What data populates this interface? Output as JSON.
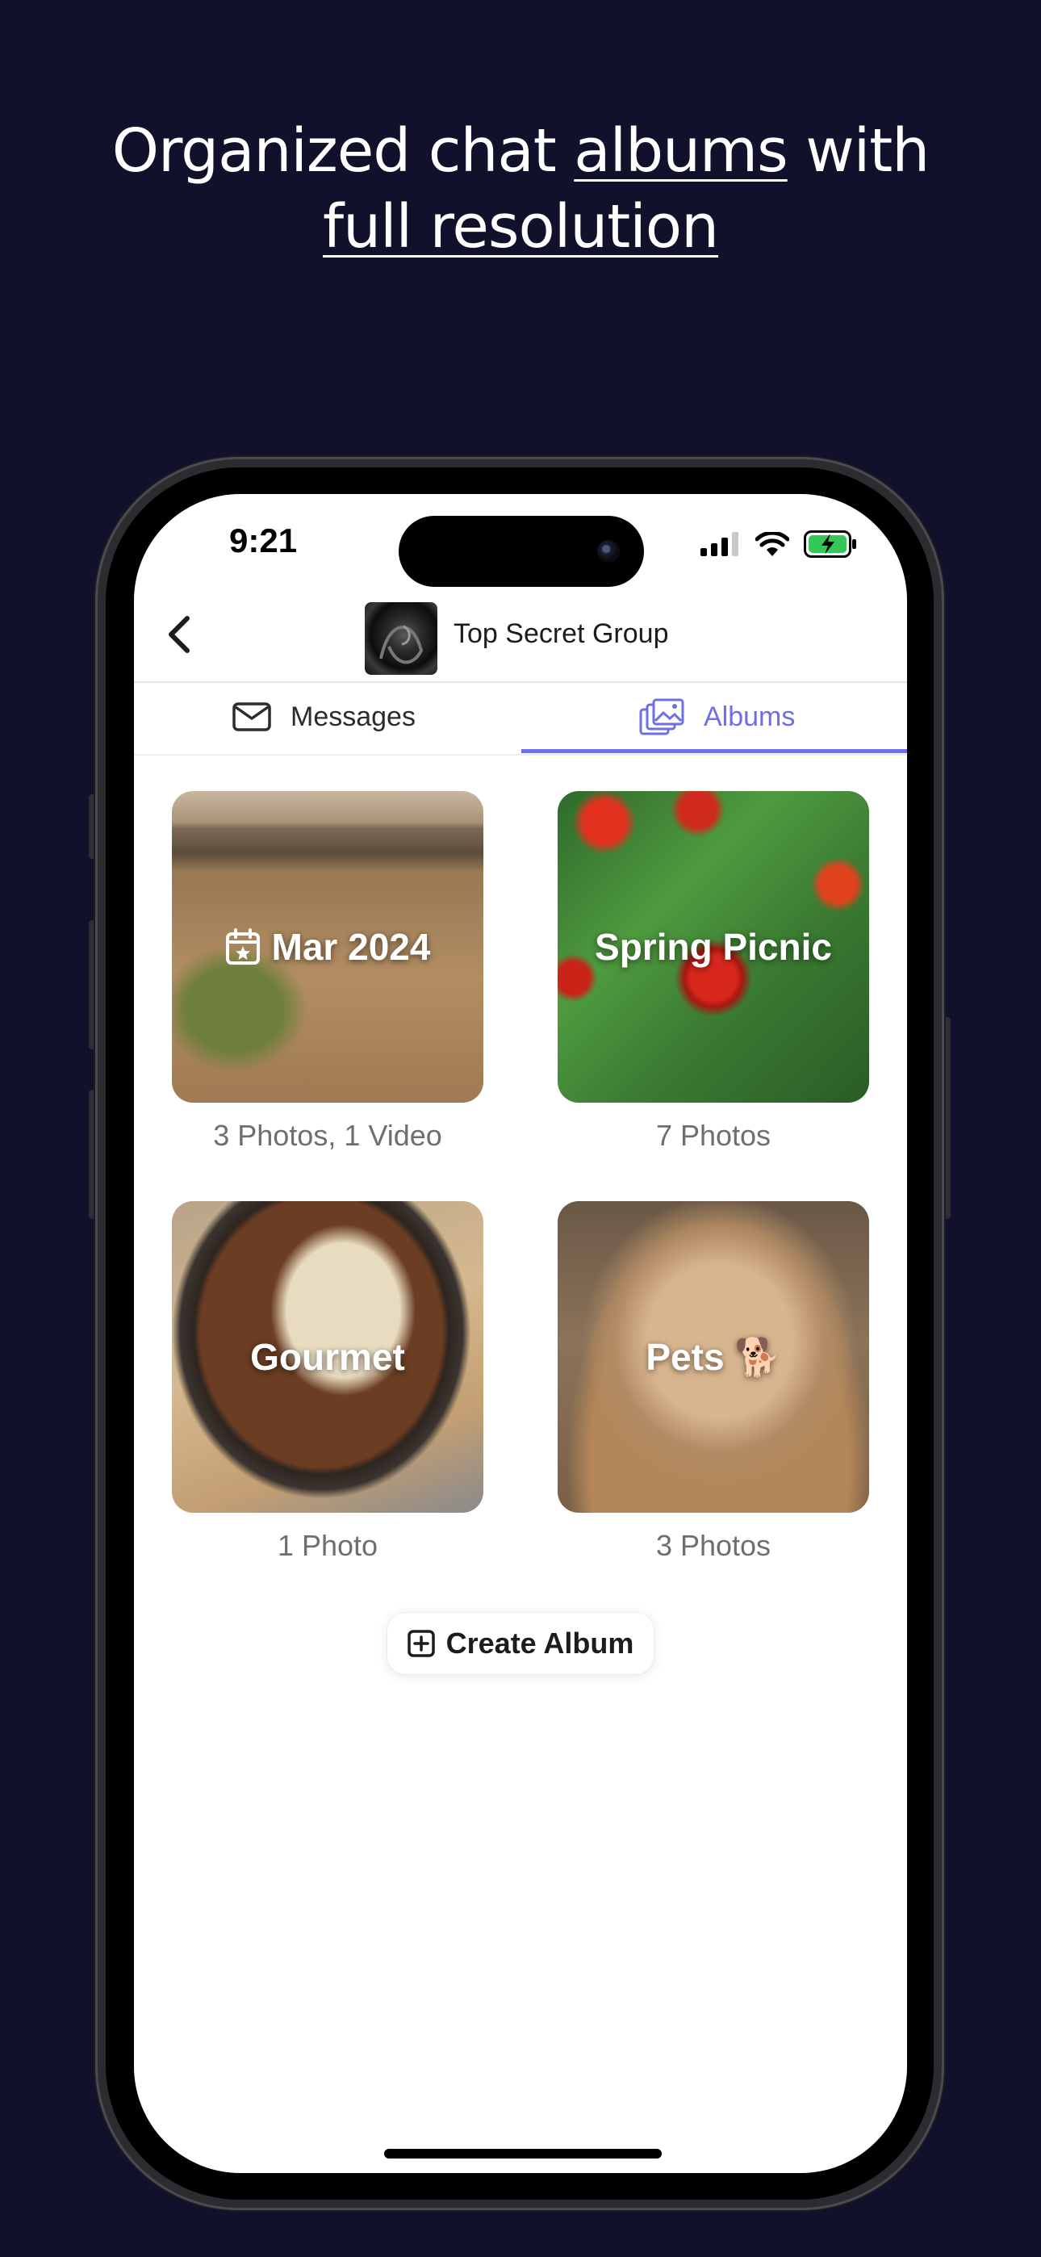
{
  "headline": {
    "part1": "Organized chat ",
    "link1": "albums",
    "part2": " with",
    "link2": "full resolution"
  },
  "status_bar": {
    "time": "9:21",
    "icons": [
      "signal-icon",
      "wifi-icon",
      "battery-charging-icon"
    ]
  },
  "nav": {
    "title": "Top Secret Group",
    "back_icon": "chevron-left-icon"
  },
  "tabs": [
    {
      "label": "Messages",
      "icon": "envelope-icon",
      "selected": false
    },
    {
      "label": "Albums",
      "icon": "photo-stack-icon",
      "selected": true
    }
  ],
  "albums": [
    {
      "title": "Mar 2024",
      "count": "3 Photos, 1 Video",
      "icon": "calendar-star-icon"
    },
    {
      "title": "Spring Picnic",
      "count": "7 Photos"
    },
    {
      "title": "Gourmet",
      "count": "1 Photo"
    },
    {
      "title": "Pets 🐕",
      "count": "3 Photos"
    }
  ],
  "create_button": {
    "label": "Create Album",
    "icon": "plus-square-icon"
  },
  "colors": {
    "background": "#11112c",
    "accent": "#6f6fe8",
    "screen": "#ffffff"
  }
}
